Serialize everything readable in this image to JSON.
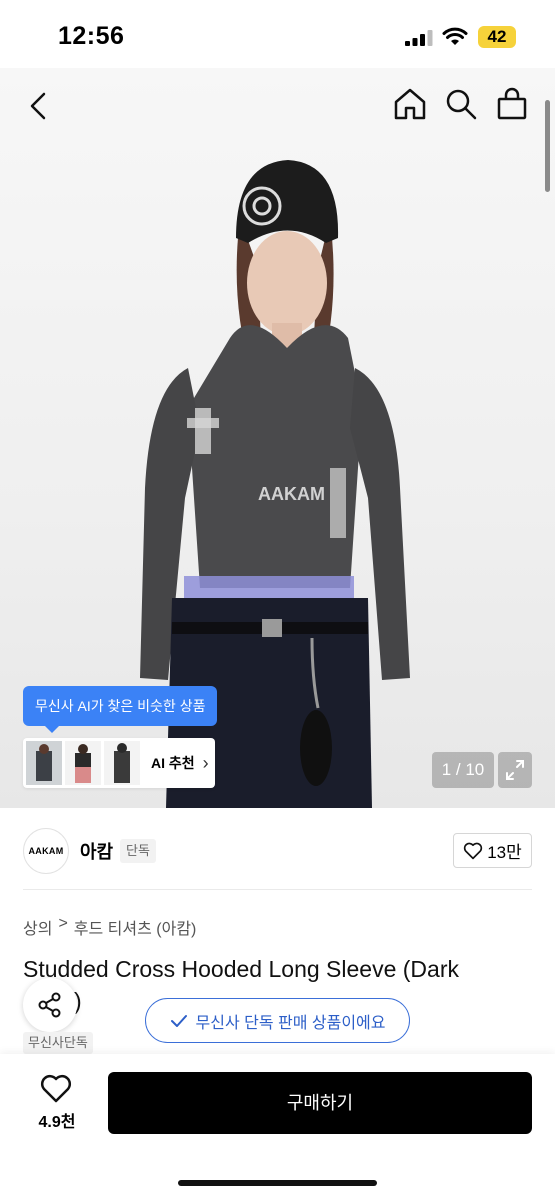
{
  "status_bar": {
    "time": "12:56",
    "battery": "42"
  },
  "gallery": {
    "ai_tooltip": "무신사 AI가 찾은 비슷한 상품",
    "ai_button_label": "AI 추천",
    "counter": "1 / 10"
  },
  "brand": {
    "logo_text": "AAKAM",
    "name": "아캄",
    "badge": "단독"
  },
  "like": {
    "count": "13만"
  },
  "breadcrumb": {
    "category": "상의",
    "separator": ">",
    "subcategory": "후드 티셔츠 (아캄)"
  },
  "product": {
    "title": "Studded Cross Hooded Long Sleeve (Dark",
    "title_tail": ")",
    "tag": "무신사단독"
  },
  "exclusive_notice": "무신사 단독 판매 상품이에요",
  "bottom": {
    "wish_count": "4.9천",
    "buy_label": "구매하기"
  },
  "colors": {
    "accent_blue": "#3b82f6",
    "buy": "#000000"
  }
}
